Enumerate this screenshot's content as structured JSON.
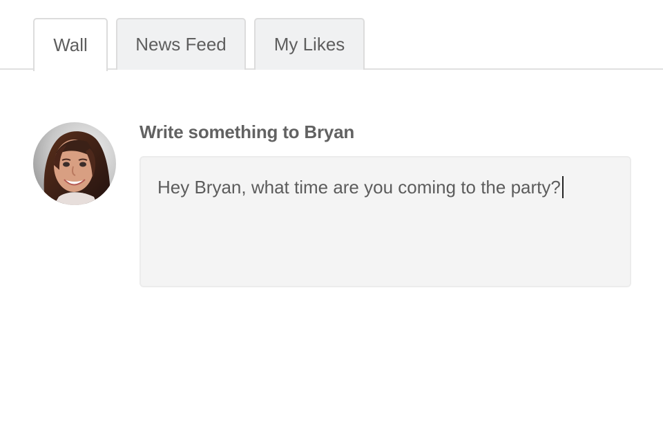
{
  "tabs": [
    {
      "label": "Wall",
      "active": true
    },
    {
      "label": "News Feed",
      "active": false
    },
    {
      "label": "My Likes",
      "active": false
    }
  ],
  "composer": {
    "label": "Write something to Bryan",
    "value": "Hey Bryan, what time are you coming to the party?"
  },
  "avatar": {
    "icon": "user-photo"
  },
  "colors": {
    "tab_background": "#f0f1f2",
    "active_tab_background": "#ffffff",
    "input_background": "#f4f4f4",
    "text": "#5e5e5e"
  }
}
